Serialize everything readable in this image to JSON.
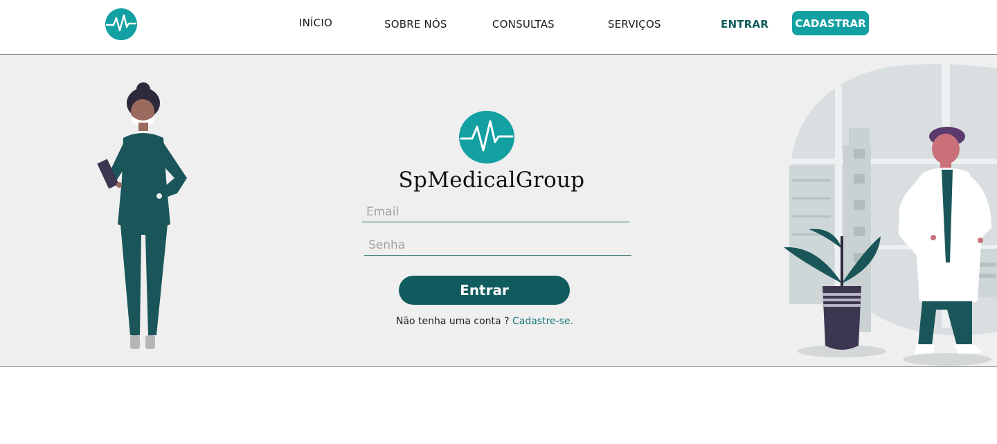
{
  "header": {
    "logo_icon": "heartbeat-logo-icon",
    "nav": {
      "inicio": "INÍCIO",
      "sobre": "SOBRE NÓS",
      "consultas": "CONSULTAS",
      "servicos": "SERVIÇOS",
      "entrar": "ENTRAR"
    },
    "cadastrar_label": "CADASTRAR"
  },
  "login": {
    "brand": "SpMedicalGroup",
    "email_placeholder": "Email",
    "senha_placeholder": "Senha",
    "submit_label": "Entrar",
    "signup_prompt": "Não tenha uma conta ?",
    "signup_link": "Cadastre-se."
  },
  "colors": {
    "brand_teal": "#13a0a3",
    "dark_teal": "#0f5b5d",
    "panel_bg": "#efefef"
  },
  "illustrations": [
    "nurse-illustration",
    "doctor-with-plant-illustration"
  ]
}
